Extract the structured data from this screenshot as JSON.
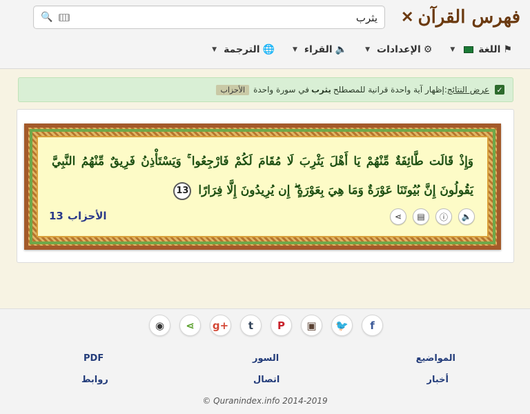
{
  "header": {
    "logo_text": "فهرس القرآن",
    "search": {
      "value": "يثرب",
      "placeholder": ""
    },
    "nav": [
      {
        "label": "الترجمة",
        "icon": "globe-icon"
      },
      {
        "label": "القراء",
        "icon": "speaker-icon"
      },
      {
        "label": "الإعدادات",
        "icon": "gear-icon"
      },
      {
        "label": "اللغة",
        "icon": "flag-icon"
      }
    ]
  },
  "notice": {
    "prefix": "عرض النتائج",
    "sep": " : ",
    "text1": "إظهار آية واحدة قرانية للمصطلح",
    "term": "يثرب",
    "text2": "في سورة واحدة",
    "surah": "الأحزاب"
  },
  "result": {
    "verse": "وَإِذْ قَالَت طَّائِفَةٌ مِّنْهُمْ يَا أَهْلَ يَثْرِبَ لَا مُقَامَ لَكُمْ فَارْجِعُوا ۚ وَيَسْتَأْذِنُ فَرِيقٌ مِّنْهُمُ النَّبِيَّ يَقُولُونَ إِنَّ بُيُوتَنَا عَوْرَةٌ وَمَا هِيَ بِعَوْرَةٍ ۖ إِن يُرِيدُونَ إِلَّا فِرَارًا",
    "ayah_number": "13",
    "surah_name": "الأحزاب",
    "surah_ayah": "13"
  },
  "footer": {
    "social_icons": [
      "github-icon",
      "share-icon",
      "google-plus-icon",
      "tumblr-icon",
      "pinterest-icon",
      "instagram-icon",
      "twitter-icon",
      "facebook-icon"
    ],
    "social_glyphs": [
      "◉",
      "⋖",
      "g+",
      "t",
      "P",
      "▣",
      "🐦",
      "f"
    ],
    "links": {
      "topics": "المواضيع",
      "suras": "السور",
      "pdf": "PDF",
      "news": "أخبار",
      "contact": "اتصال",
      "links": "روابط"
    },
    "copyright": "© Quranindex.info 2014-2019"
  }
}
